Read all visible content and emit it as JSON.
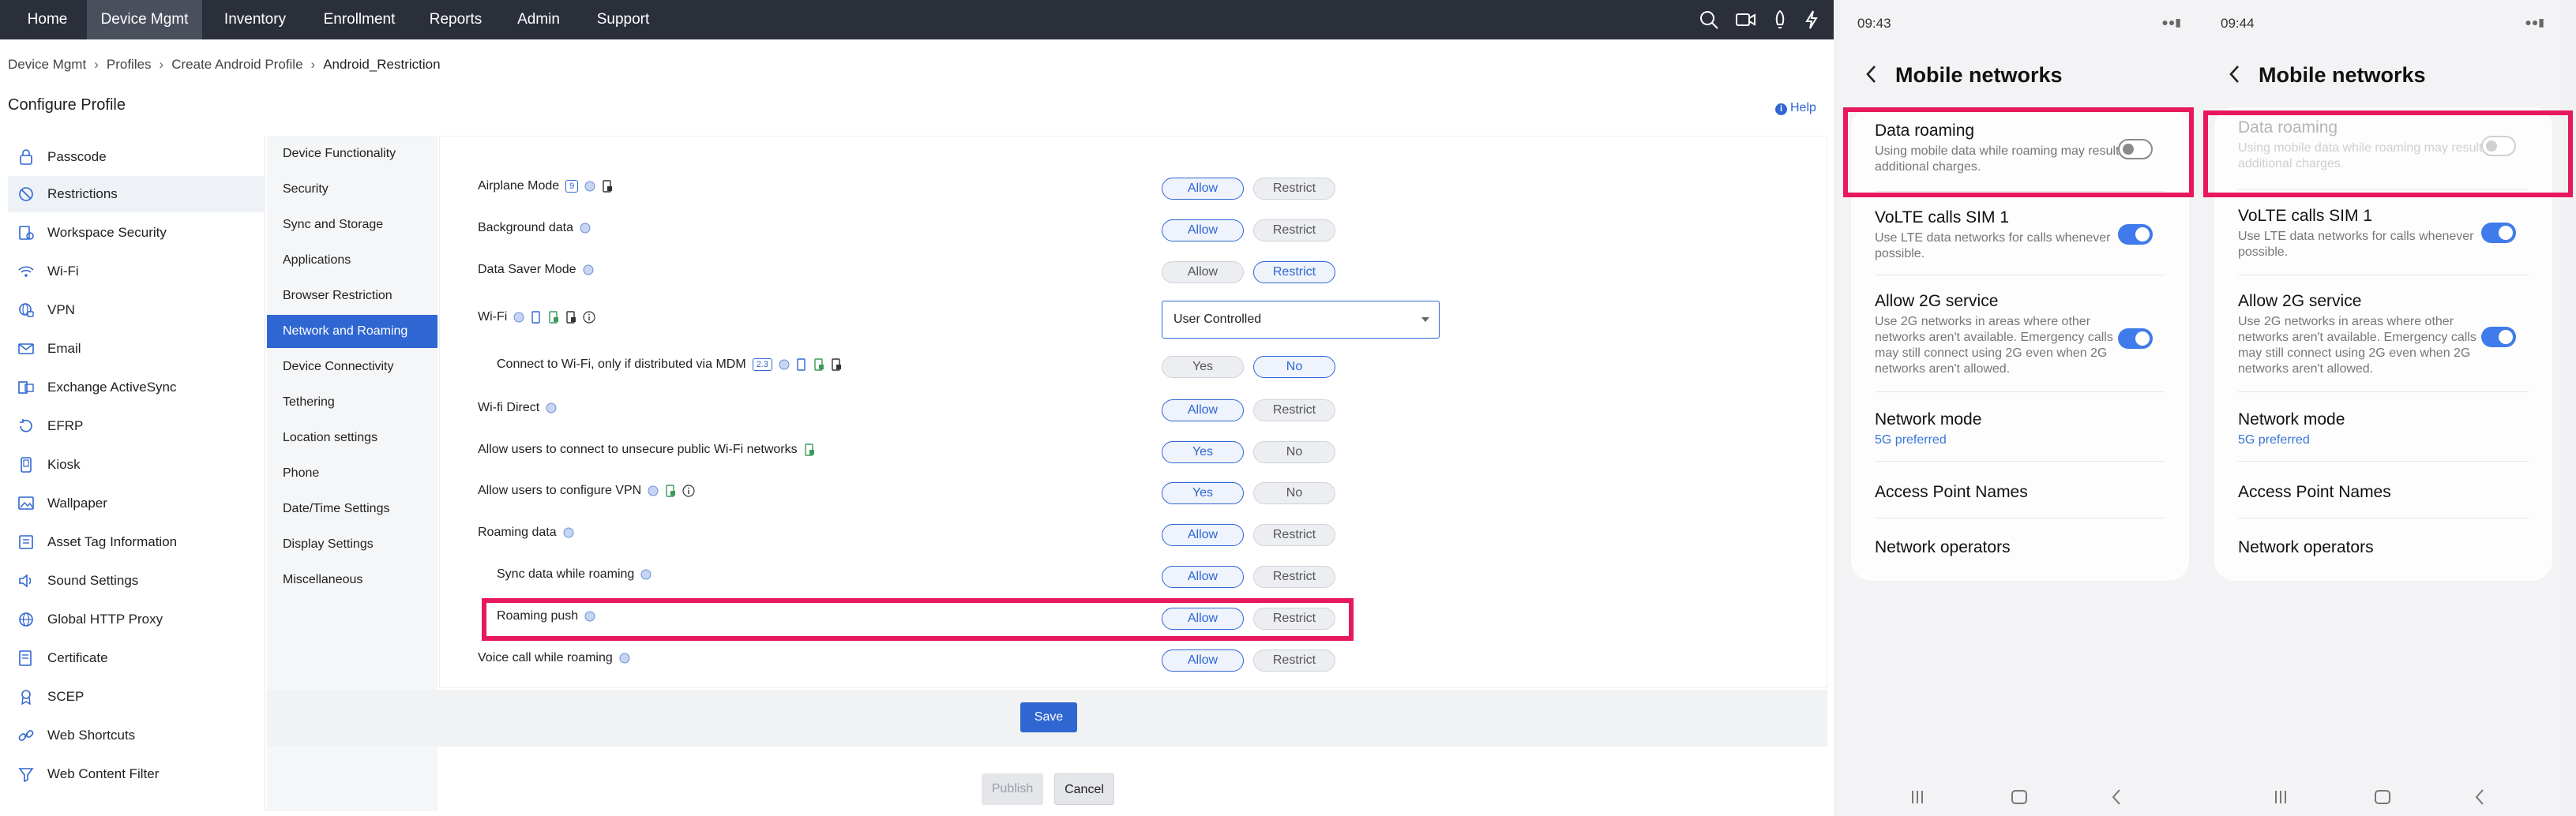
{
  "nav": {
    "tabs": [
      "Home",
      "Device Mgmt",
      "Inventory",
      "Enrollment",
      "Reports",
      "Admin",
      "Support"
    ],
    "active": "Device Mgmt"
  },
  "breadcrumb": [
    "Device Mgmt",
    "Profiles",
    "Create Android Profile",
    "Android_Restriction"
  ],
  "page_title": "Configure Profile",
  "help_label": "Help",
  "profile_items": [
    "Passcode",
    "Restrictions",
    "Workspace Security",
    "Wi-Fi",
    "VPN",
    "Email",
    "Exchange ActiveSync",
    "EFRP",
    "Kiosk",
    "Wallpaper",
    "Asset Tag Information",
    "Sound Settings",
    "Global HTTP Proxy",
    "Certificate",
    "SCEP",
    "Web Shortcuts",
    "Web Content Filter"
  ],
  "restriction_categories": [
    "Device Functionality",
    "Security",
    "Sync and Storage",
    "Applications",
    "Browser Restriction",
    "Network and Roaming",
    "Device Connectivity",
    "Tethering",
    "Location settings",
    "Phone",
    "Date/Time Settings",
    "Display Settings",
    "Miscellaneous"
  ],
  "active_category": "Network and Roaming",
  "settings": [
    {
      "label": "Airplane Mode",
      "badge": "9",
      "options": [
        "Allow",
        "Restrict"
      ],
      "selected": "Allow"
    },
    {
      "label": "Background data",
      "options": [
        "Allow",
        "Restrict"
      ],
      "selected": "Allow"
    },
    {
      "label": "Data Saver Mode",
      "options": [
        "Allow",
        "Restrict"
      ],
      "selected": "Restrict"
    },
    {
      "label": "Wi-Fi",
      "select_value": "User Controlled"
    },
    {
      "label": "Connect to Wi-Fi, only if distributed via MDM",
      "badge": "2.3",
      "options": [
        "Yes",
        "No"
      ],
      "selected": "No"
    },
    {
      "label": "Wi-fi Direct",
      "options": [
        "Allow",
        "Restrict"
      ],
      "selected": "Allow"
    },
    {
      "label": "Allow users to connect to unsecure public Wi-Fi networks",
      "options": [
        "Yes",
        "No"
      ],
      "selected": "Yes"
    },
    {
      "label": "Allow users to configure VPN",
      "options": [
        "Yes",
        "No"
      ],
      "selected": "Yes"
    },
    {
      "label": "Roaming data",
      "options": [
        "Allow",
        "Restrict"
      ],
      "selected": "Allow"
    },
    {
      "label": "Sync data while roaming",
      "options": [
        "Allow",
        "Restrict"
      ],
      "selected": "Allow"
    },
    {
      "label": "Roaming push",
      "options": [
        "Allow",
        "Restrict"
      ],
      "selected": "Allow"
    },
    {
      "label": "Voice call while roaming",
      "options": [
        "Allow",
        "Restrict"
      ],
      "selected": "Allow"
    }
  ],
  "buttons": {
    "save": "Save",
    "publish": "Publish",
    "cancel": "Cancel"
  },
  "phones": [
    {
      "time": "09:43",
      "title": "Mobile networks",
      "roaming_disabled": false
    },
    {
      "time": "09:44",
      "title": "Mobile networks",
      "roaming_disabled": true
    }
  ],
  "phone_items": {
    "data_roaming": {
      "title": "Data roaming",
      "sub": "Using mobile data while roaming may result in additional charges."
    },
    "volte": {
      "title": "VoLTE calls SIM 1",
      "sub": "Use LTE data networks for calls whenever possible."
    },
    "allow2g": {
      "title": "Allow 2G service",
      "sub": "Use 2G networks in areas where other networks aren't available. Emergency calls may still connect using 2G even when 2G networks aren't allowed."
    },
    "network_mode": {
      "title": "Network mode",
      "sub": "5G preferred"
    },
    "apn": {
      "title": "Access Point Names"
    },
    "operators": {
      "title": "Network operators"
    }
  },
  "colors": {
    "accent": "#2f66d2",
    "highlight": "#e8185c",
    "nav_bg": "#2b2f3a"
  }
}
